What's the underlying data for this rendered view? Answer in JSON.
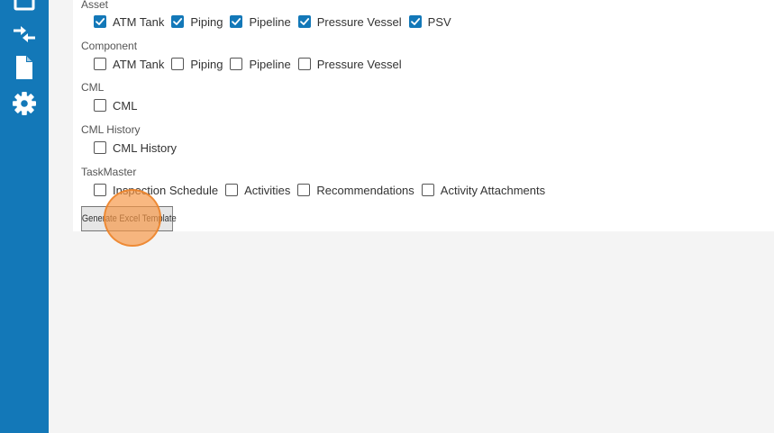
{
  "sidebar": {
    "icons": [
      "square-icon",
      "swap-arrows-icon",
      "document-icon",
      "gear-icon"
    ]
  },
  "groups": [
    {
      "label": "Asset",
      "items": [
        {
          "label": "ATM Tank",
          "checked": true
        },
        {
          "label": "Piping",
          "checked": true
        },
        {
          "label": "Pipeline",
          "checked": true
        },
        {
          "label": "Pressure Vessel",
          "checked": true
        },
        {
          "label": "PSV",
          "checked": true
        }
      ]
    },
    {
      "label": "Component",
      "items": [
        {
          "label": "ATM Tank",
          "checked": false
        },
        {
          "label": "Piping",
          "checked": false
        },
        {
          "label": "Pipeline",
          "checked": false
        },
        {
          "label": "Pressure Vessel",
          "checked": false
        }
      ]
    },
    {
      "label": "CML",
      "items": [
        {
          "label": "CML",
          "checked": false
        }
      ]
    },
    {
      "label": "CML History",
      "items": [
        {
          "label": "CML History",
          "checked": false
        }
      ]
    },
    {
      "label": "TaskMaster",
      "items": [
        {
          "label": "Inspection Schedule",
          "checked": false
        },
        {
          "label": "Activities",
          "checked": false
        },
        {
          "label": "Recommendations",
          "checked": false
        },
        {
          "label": "Activity Attachments",
          "checked": false
        }
      ]
    }
  ],
  "generate_button": {
    "label": "Generate Excel Template"
  },
  "colors": {
    "sidebar": "#1378b8",
    "checkbox_checked": "#1378b8",
    "click_highlight": "#f69646"
  }
}
